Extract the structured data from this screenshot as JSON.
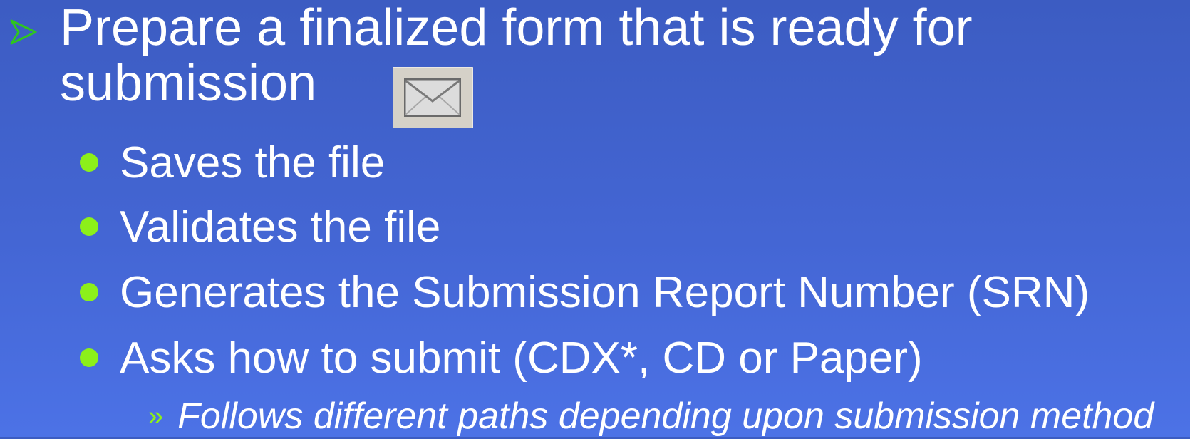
{
  "slide": {
    "heading": {
      "line1": "Prepare a finalized form that is ready for",
      "line2": "submission",
      "bullet_icon": "arrow-right-icon",
      "inline_icon": "envelope-icon"
    },
    "bullets": [
      {
        "text": "Saves the file"
      },
      {
        "text": "Validates the file"
      },
      {
        "text": "Generates the Submission Report Number (SRN)"
      },
      {
        "text": "Asks how to submit (CDX*, CD or Paper)"
      }
    ],
    "sub_bullet": {
      "marker": "»",
      "text": "Follows different paths depending upon submission method"
    },
    "colors": {
      "background_top": "#3c5cc2",
      "background_bottom": "#4c72e6",
      "bullet_green": "#8cf01a",
      "text": "#ffffff"
    }
  }
}
